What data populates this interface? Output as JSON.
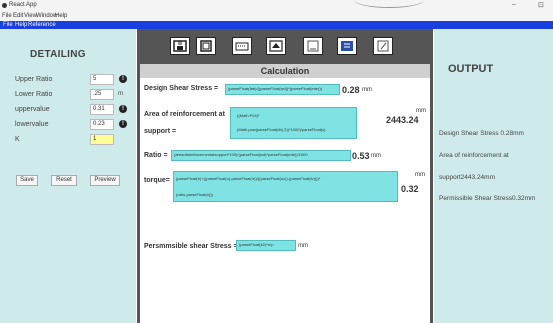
{
  "window": {
    "title": "React App",
    "minimize": "–",
    "restore": "⊡"
  },
  "menubar": [
    "File",
    "Edit",
    "View",
    "Window",
    "Help"
  ],
  "appmenu": [
    "File",
    "Help",
    "Reference"
  ],
  "left": {
    "heading": "DETAILING",
    "fields": [
      {
        "label": "Upper Ratio",
        "value": "5",
        "info": "!"
      },
      {
        "label": "Lower Ratio",
        "value": ".25",
        "info": "m"
      },
      {
        "label": "uppervalue",
        "value": "0.31",
        "info": "!"
      },
      {
        "label": "lowervalue",
        "value": "0.23",
        "info": "!"
      },
      {
        "label": "K",
        "value": "1",
        "info": ""
      }
    ],
    "buttons": {
      "save": "Save",
      "reset": "Reset",
      "preview": "Preview"
    }
  },
  "toolbar": [
    "save-icon",
    "copy-icon",
    "calculator-icon",
    "chart-icon",
    "document-icon",
    "table-icon",
    "edit-icon"
  ],
  "calc": {
    "title": "Calculation",
    "rows": [
      {
        "label": "Design Shear Stress =",
        "formula": "(parseFloat(fab)/((parseFloat(wd))*(parseFloat(ede)))",
        "result": "0.28",
        "unit": "mm"
      },
      {
        "label1": "Area of reinforcement at",
        "label2": "support =",
        "formula1": "((Math.PI/4)*",
        "formula2": "(Math.pow(parseFloat(db),2))*1000)/parseFloat(s)",
        "result": "2443.24",
        "unit": "mm"
      },
      {
        "label": "Ratio =",
        "formula": "(areaofreinforcementatsupport*100)/(parseFloat(wd)*parseFloat(ede))/1000",
        "result": "0.53",
        "unit": "mm"
      },
      {
        "label": "torque=",
        "formula1": "(parseFloat(Ir)+((parseFloat(u)-parseFloat(Ir))/((parseFloat(uv))-(parseFloat(lv))))*",
        "formula2": "(ratio-parseFloat(lr)))",
        "result": "0.32",
        "unit": "mm"
      },
      {
        "label": "Persmmsible shear Stress =",
        "formula": "(parseFloat(k2)*tc)=",
        "unit": "mm"
      }
    ]
  },
  "output": {
    "heading": "OUTPUT",
    "lines": [
      "Design Shear Stress 0.28mm",
      "Area of reinforcement at",
      "support2443.24mm",
      "Permissible Shear Stress0.32mm"
    ]
  }
}
